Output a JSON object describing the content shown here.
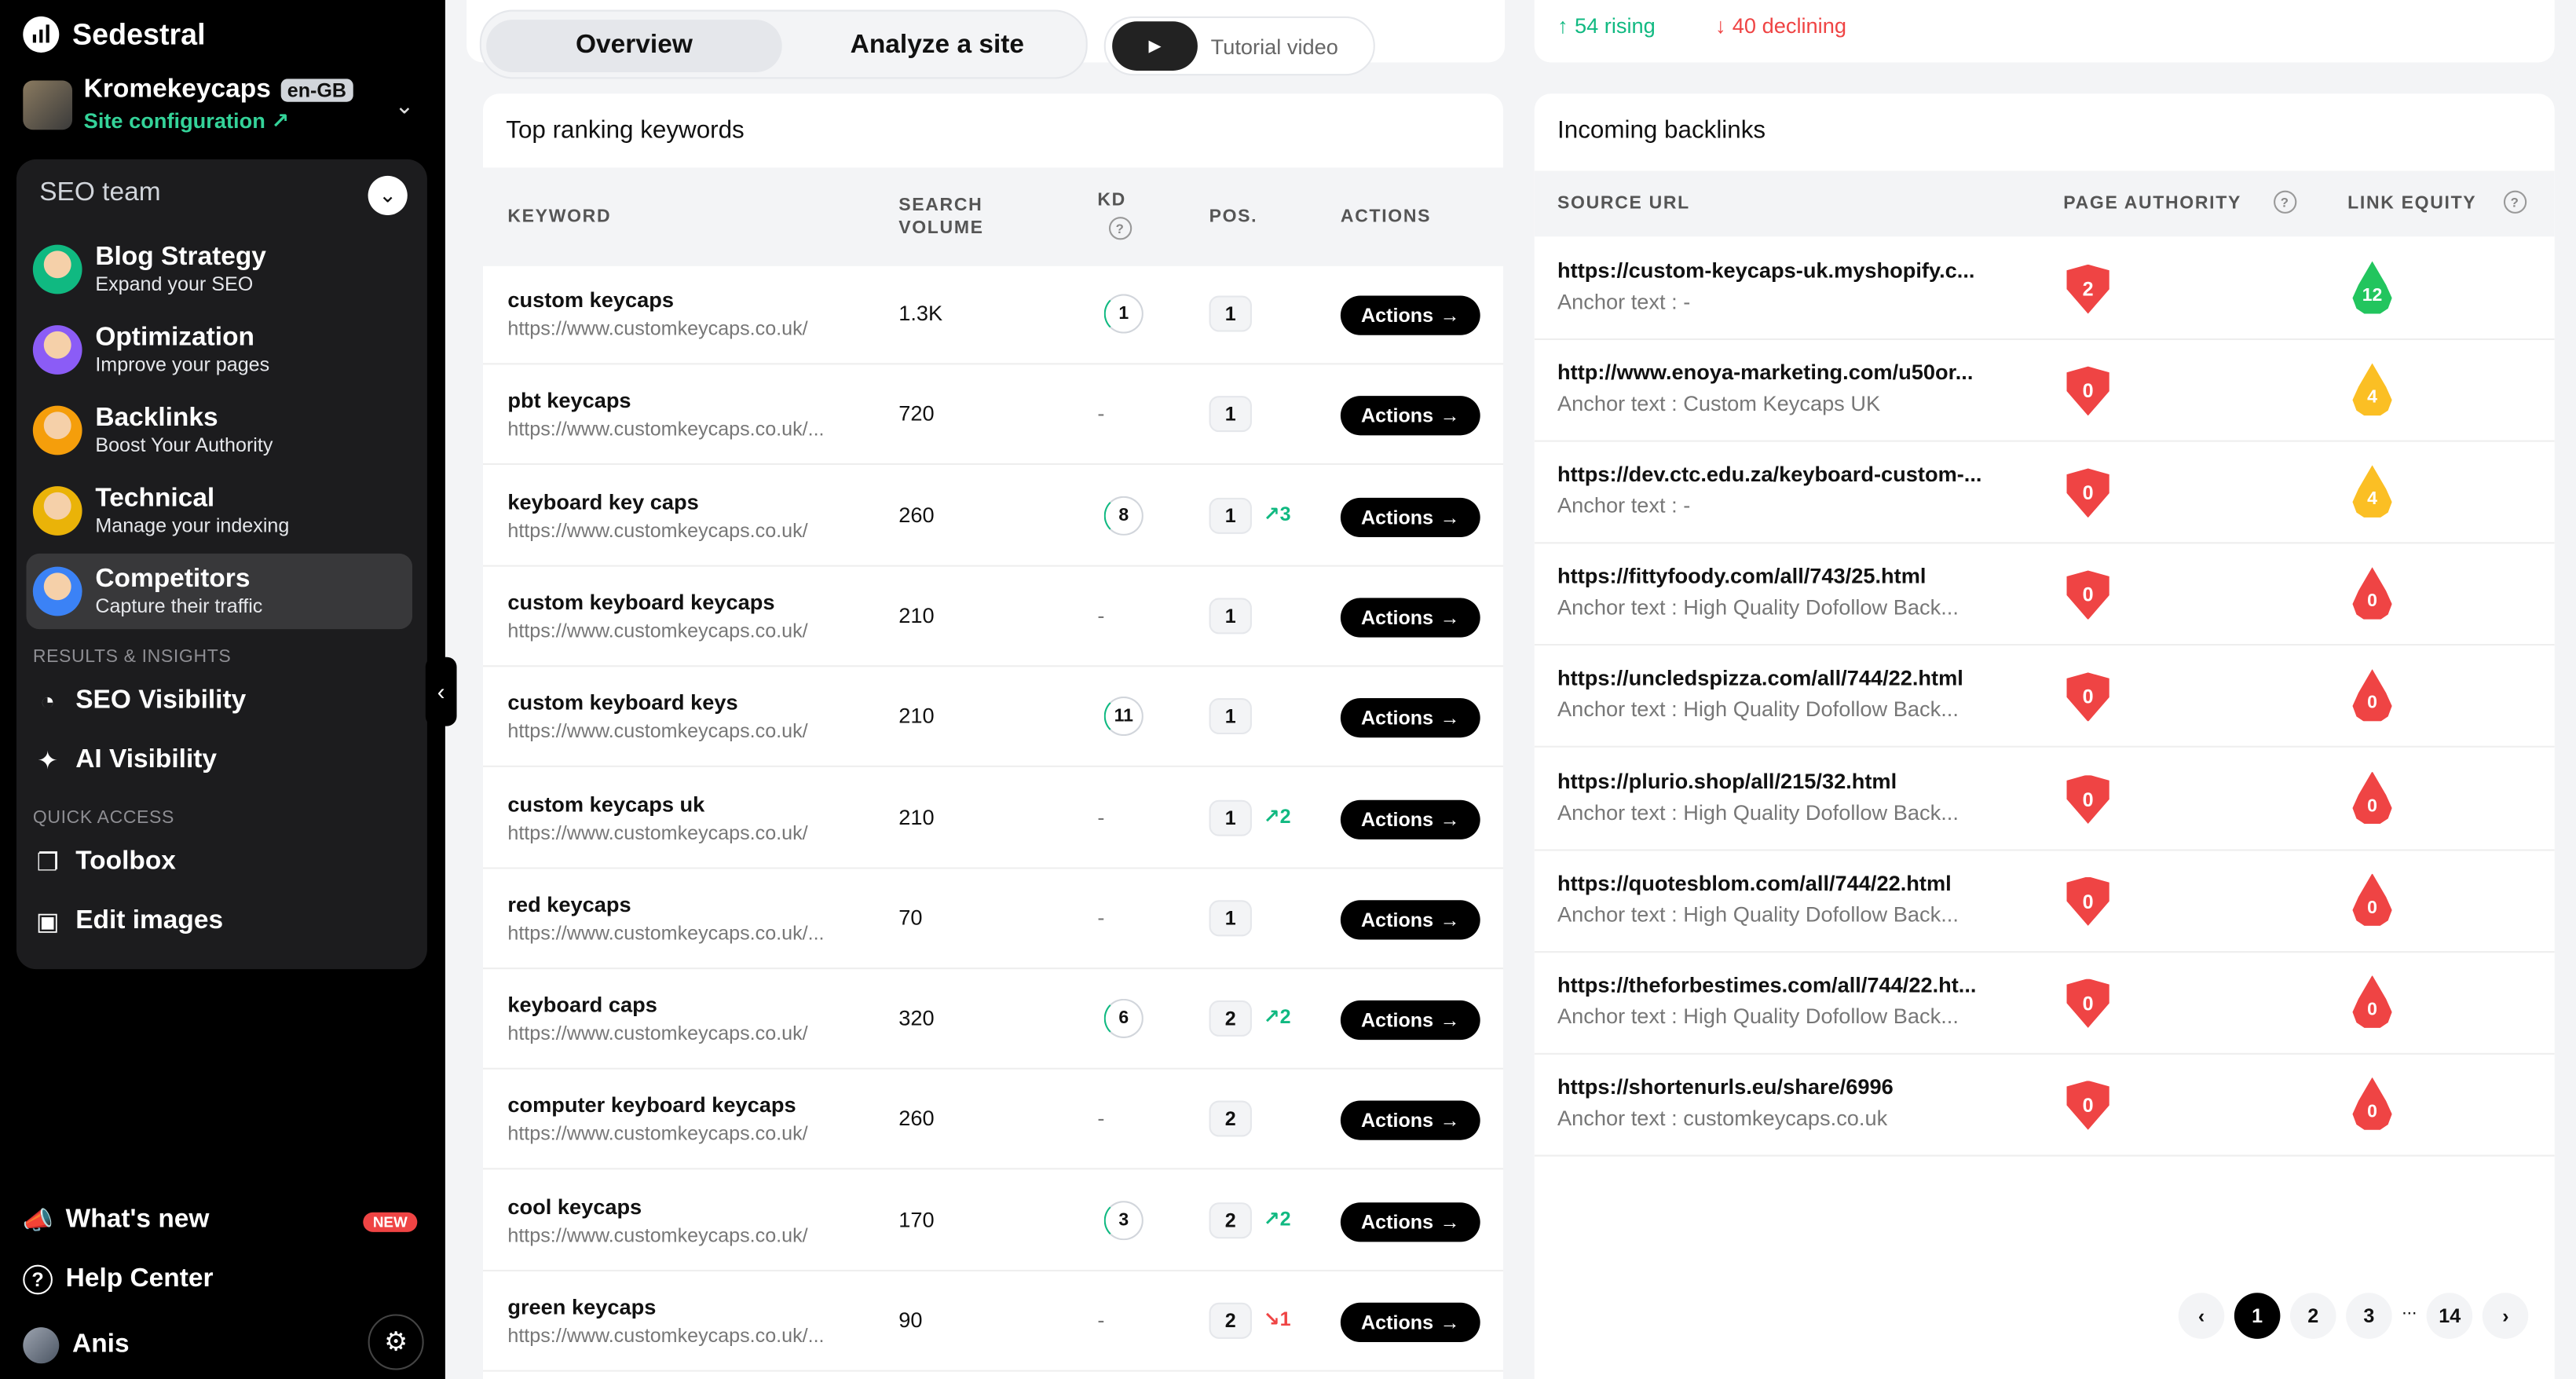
{
  "brand": {
    "name": "Sedestral"
  },
  "site": {
    "name": "Kromekeycaps",
    "locale": "en-GB",
    "config": "Site configuration ↗"
  },
  "team": {
    "title": "SEO team",
    "agents": [
      {
        "title": "Blog Strategy",
        "subtitle": "Expand your SEO",
        "color": "#10b981"
      },
      {
        "title": "Optimization",
        "subtitle": "Improve your pages",
        "color": "#8b5cf6"
      },
      {
        "title": "Backlinks",
        "subtitle": "Boost Your Authority",
        "color": "#f59e0b"
      },
      {
        "title": "Technical",
        "subtitle": "Manage your indexing",
        "color": "#eab308"
      },
      {
        "title": "Competitors",
        "subtitle": "Capture their traffic",
        "color": "#3b82f6"
      }
    ]
  },
  "results": {
    "label": "RESULTS & INSIGHTS",
    "items": [
      "SEO Visibility",
      "AI Visibility"
    ]
  },
  "quick": {
    "label": "QUICK ACCESS",
    "items": [
      "Toolbox",
      "Edit images"
    ]
  },
  "bottom": {
    "whats_new": "What's new",
    "new_badge": "NEW",
    "help": "Help Center",
    "user": "Anis"
  },
  "tabs": {
    "overview": "Overview",
    "analyze": "Analyze a site",
    "tutorial": "Tutorial video"
  },
  "trends": {
    "rising": "54 rising",
    "declining": "40 declining"
  },
  "keywords": {
    "title": "Top ranking keywords",
    "headers": {
      "keyword": "KEYWORD",
      "volume1": "SEARCH",
      "volume2": "VOLUME",
      "kd": "KD",
      "pos": "POS.",
      "actions": "ACTIONS"
    },
    "action_label": "Actions",
    "rows": [
      {
        "kw": "custom keycaps",
        "url": "https://www.customkeycaps.co.uk/",
        "vol": "1.3K",
        "kd": "1",
        "pos": "1",
        "delta": ""
      },
      {
        "kw": "pbt keycaps",
        "url": "https://www.customkeycaps.co.uk/...",
        "vol": "720",
        "kd": "-",
        "pos": "1",
        "delta": ""
      },
      {
        "kw": "keyboard key caps",
        "url": "https://www.customkeycaps.co.uk/",
        "vol": "260",
        "kd": "8",
        "pos": "1",
        "delta": "↗3"
      },
      {
        "kw": "custom keyboard keycaps",
        "url": "https://www.customkeycaps.co.uk/",
        "vol": "210",
        "kd": "-",
        "pos": "1",
        "delta": ""
      },
      {
        "kw": "custom keyboard keys",
        "url": "https://www.customkeycaps.co.uk/",
        "vol": "210",
        "kd": "11",
        "pos": "1",
        "delta": ""
      },
      {
        "kw": "custom keycaps uk",
        "url": "https://www.customkeycaps.co.uk/",
        "vol": "210",
        "kd": "-",
        "pos": "1",
        "delta": "↗2"
      },
      {
        "kw": "red keycaps",
        "url": "https://www.customkeycaps.co.uk/...",
        "vol": "70",
        "kd": "-",
        "pos": "1",
        "delta": ""
      },
      {
        "kw": "keyboard caps",
        "url": "https://www.customkeycaps.co.uk/",
        "vol": "320",
        "kd": "6",
        "pos": "2",
        "delta": "↗2"
      },
      {
        "kw": "computer keyboard keycaps",
        "url": "https://www.customkeycaps.co.uk/",
        "vol": "260",
        "kd": "-",
        "pos": "2",
        "delta": ""
      },
      {
        "kw": "cool keycaps",
        "url": "https://www.customkeycaps.co.uk/",
        "vol": "170",
        "kd": "3",
        "pos": "2",
        "delta": "↗2"
      },
      {
        "kw": "green keycaps",
        "url": "https://www.customkeycaps.co.uk/...",
        "vol": "90",
        "kd": "-",
        "pos": "2",
        "delta": "↘1"
      }
    ]
  },
  "backlinks": {
    "title": "Incoming backlinks",
    "headers": {
      "source": "SOURCE URL",
      "pa": "PAGE AUTHORITY",
      "le": "LINK EQUITY"
    },
    "rows": [
      {
        "url": "https://custom-keycaps-uk.myshopify.c...",
        "anchor": "Anchor text : -",
        "pa": "2",
        "le": "12",
        "le_color": "#22c55e"
      },
      {
        "url": "http://www.enoya-marketing.com/u50or...",
        "anchor": "Anchor text : Custom Keycaps UK",
        "pa": "0",
        "le": "4",
        "le_color": "#fbbf24"
      },
      {
        "url": "https://dev.ctc.edu.za/keyboard-custom-...",
        "anchor": "Anchor text : -",
        "pa": "0",
        "le": "4",
        "le_color": "#fbbf24"
      },
      {
        "url": "https://fittyfoody.com/all/743/25.html",
        "anchor": "Anchor text : High Quality Dofollow Back...",
        "pa": "0",
        "le": "0",
        "le_color": "#ef4444"
      },
      {
        "url": "https://uncledspizza.com/all/744/22.html",
        "anchor": "Anchor text : High Quality Dofollow Back...",
        "pa": "0",
        "le": "0",
        "le_color": "#ef4444"
      },
      {
        "url": "https://plurio.shop/all/215/32.html",
        "anchor": "Anchor text : High Quality Dofollow Back...",
        "pa": "0",
        "le": "0",
        "le_color": "#ef4444"
      },
      {
        "url": "https://quotesblom.com/all/744/22.html",
        "anchor": "Anchor text : High Quality Dofollow Back...",
        "pa": "0",
        "le": "0",
        "le_color": "#ef4444"
      },
      {
        "url": "https://theforbestimes.com/all/744/22.ht...",
        "anchor": "Anchor text : High Quality Dofollow Back...",
        "pa": "0",
        "le": "0",
        "le_color": "#ef4444"
      },
      {
        "url": "https://shortenurls.eu/share/6996",
        "anchor": "Anchor text : customkeycaps.co.uk",
        "pa": "0",
        "le": "0",
        "le_color": "#ef4444"
      }
    ]
  },
  "pagination": {
    "pages": [
      "1",
      "2",
      "3"
    ],
    "ellipsis": "...",
    "last": "14",
    "current": "1"
  }
}
